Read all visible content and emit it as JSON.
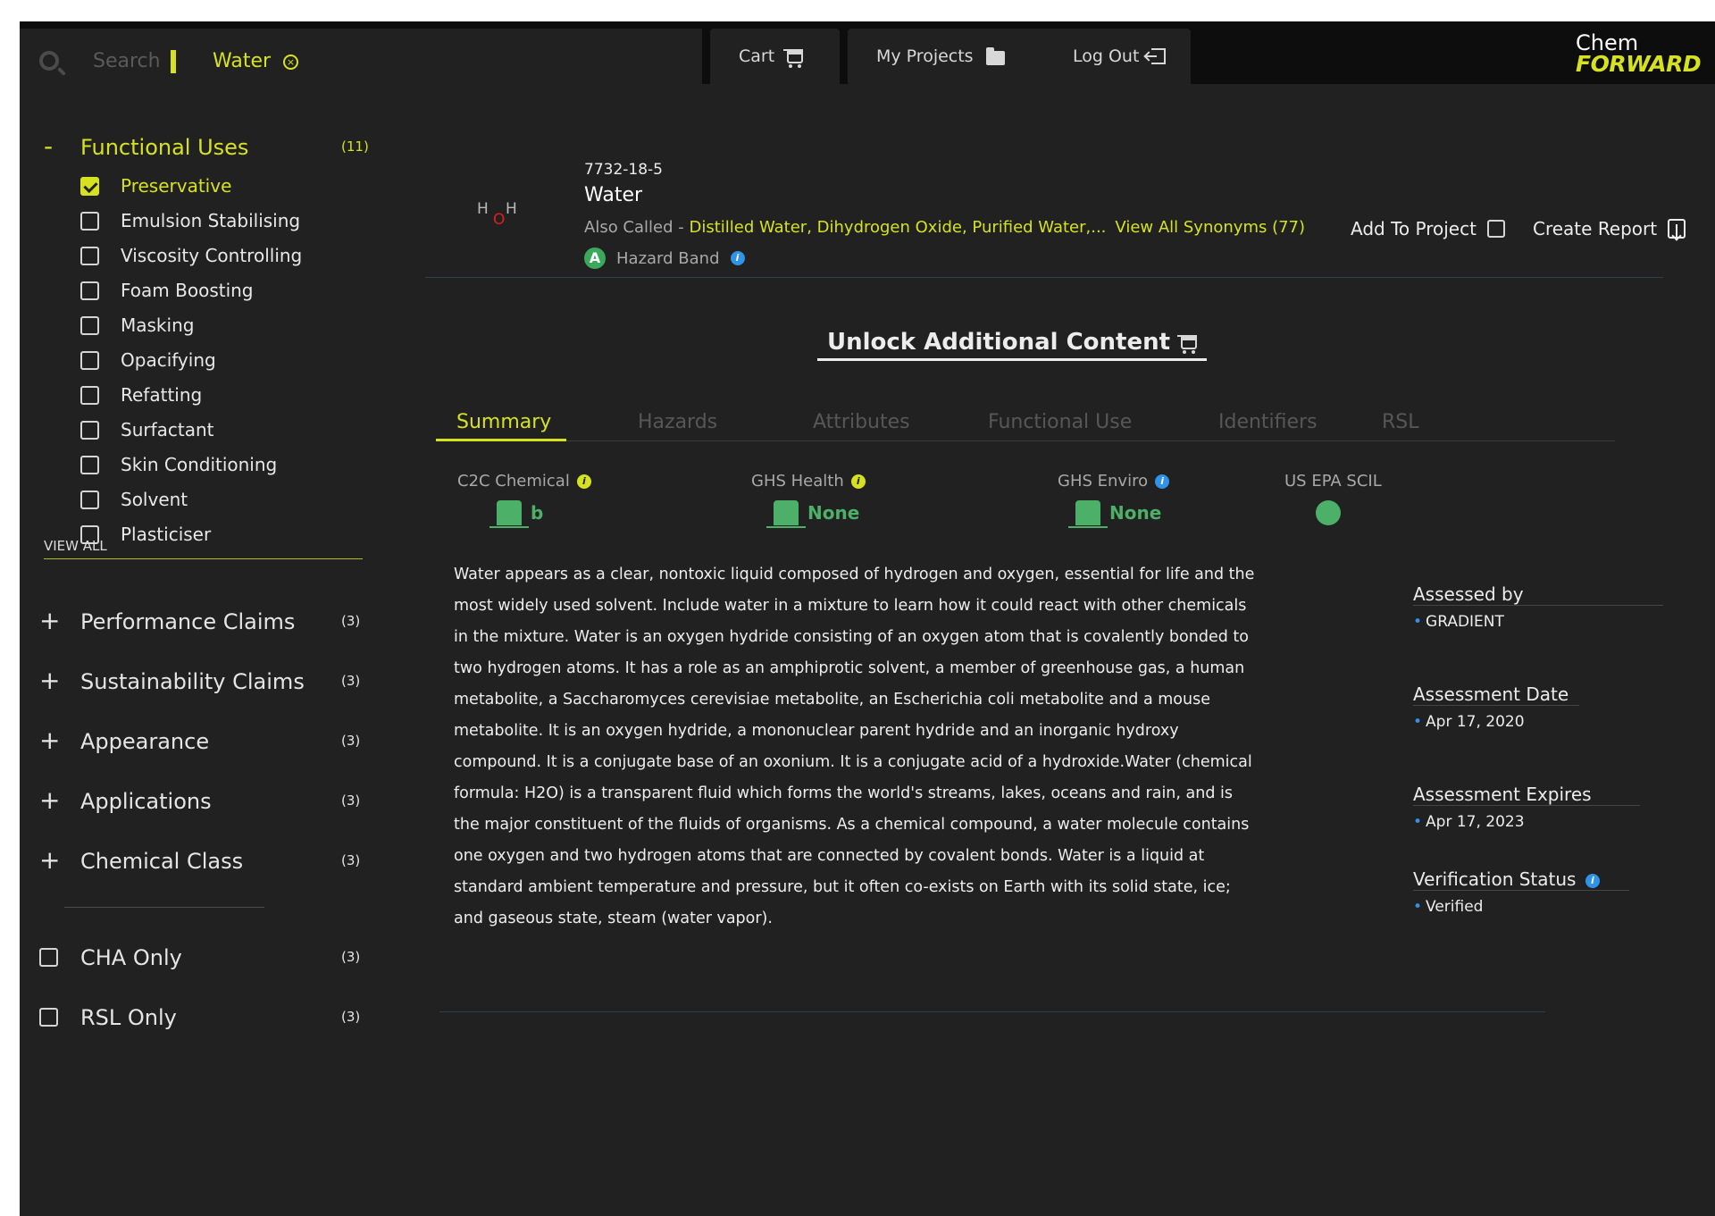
{
  "topbar": {
    "search_placeholder": "Search",
    "search_chip": "Water",
    "search_chip_close_icon": "close-circle-icon",
    "cart_label": "Cart",
    "projects_label": "My Projects",
    "logout_label": "Log Out",
    "logo_line1": "Chem",
    "logo_line2": "FORWARD"
  },
  "sidebar": {
    "functional_uses": {
      "label": "Functional Uses",
      "sign": "-",
      "count": "(11)",
      "items": [
        {
          "label": "Preservative",
          "checked": true
        },
        {
          "label": "Emulsion Stabilising",
          "checked": false
        },
        {
          "label": "Viscosity Controlling",
          "checked": false
        },
        {
          "label": "Foam Boosting",
          "checked": false
        },
        {
          "label": "Masking",
          "checked": false
        },
        {
          "label": "Opacifying",
          "checked": false
        },
        {
          "label": "Refatting",
          "checked": false
        },
        {
          "label": "Surfactant",
          "checked": false
        },
        {
          "label": "Skin Conditioning",
          "checked": false
        },
        {
          "label": "Solvent",
          "checked": false
        },
        {
          "label": "Plasticiser",
          "checked": false
        }
      ],
      "view_all": "VIEW ALL"
    },
    "groups": [
      {
        "label": "Performance Claims",
        "count": "(3)",
        "sign": "+"
      },
      {
        "label": "Sustainability Claims",
        "count": "(3)",
        "sign": "+"
      },
      {
        "label": "Appearance",
        "count": "(3)",
        "sign": "+"
      },
      {
        "label": "Applications",
        "count": "(3)",
        "sign": "+"
      },
      {
        "label": "Chemical Class",
        "count": "(3)",
        "sign": "+"
      }
    ],
    "only_filters": [
      {
        "label": "CHA Only",
        "count": "(3)"
      },
      {
        "label": "RSL Only",
        "count": "(3)"
      }
    ]
  },
  "chemical": {
    "molecule_h1": "H",
    "molecule_o": "O",
    "molecule_h2": "H",
    "cas": "7732-18-5",
    "name": "Water",
    "also_called_label": "Also Called - ",
    "synonyms": "Distilled Water, Dihydrogen Oxide, Purified Water,...",
    "view_synonyms": "View All Synonyms (77)",
    "hazard_band_letter": "A",
    "hazard_band_label": "Hazard Band",
    "add_to_project": "Add To Project",
    "create_report": "Create Report"
  },
  "unlock": {
    "label": "Unlock Additional Content"
  },
  "tabs": [
    "Summary",
    "Hazards",
    "Attributes",
    "Functional Use",
    "Identifiers",
    "RSL"
  ],
  "scores": [
    {
      "label": "C2C Chemical",
      "value": "b",
      "info_color": "#d6e21f"
    },
    {
      "label": "GHS Health",
      "value": "None",
      "info_color": "#d6e21f"
    },
    {
      "label": "GHS Enviro",
      "value": "None",
      "info_color": "#2f93e8"
    },
    {
      "label": "US EPA SCIL",
      "value": ""
    }
  ],
  "description": "Water appears as a clear, nontoxic liquid composed of hydrogen and oxygen, essential for life and the most widely used solvent. Include water in a mixture to learn how it could react with other chemicals in the mixture. Water is an oxygen hydride consisting of an oxygen atom that is covalently bonded to two hydrogen atoms. It has a role as an amphiprotic solvent, a member of greenhouse gas, a human metabolite, a Saccharomyces cerevisiae metabolite, an Escherichia coli metabolite and a mouse metabolite. It is an oxygen hydride, a mononuclear parent hydride and an inorganic hydroxy compound. It is a conjugate base of an oxonium. It is a conjugate acid of a hydroxide.Water (chemical formula: H2O) is a transparent fluid which forms the world's streams, lakes, oceans and rain, and is the major constituent of the fluids of organisms. As a chemical compound, a water molecule contains one oxygen and two hydrogen atoms that are connected by covalent bonds. Water is a liquid at standard ambient temperature and pressure, but it often co-exists on Earth with its solid state, ice; and gaseous state, steam (water vapor).",
  "assessment": {
    "assessed_by_label": "Assessed by",
    "assessed_by": "GRADIENT",
    "date_label": "Assessment Date",
    "date": "Apr 17, 2020",
    "expires_label": "Assessment Expires",
    "expires": "Apr 17, 2023",
    "verification_label": "Verification Status",
    "verification": "Verified"
  },
  "colors": {
    "accent": "#d6e21f",
    "green": "#4db069",
    "info_blue": "#2f93e8",
    "panel": "#212121"
  }
}
